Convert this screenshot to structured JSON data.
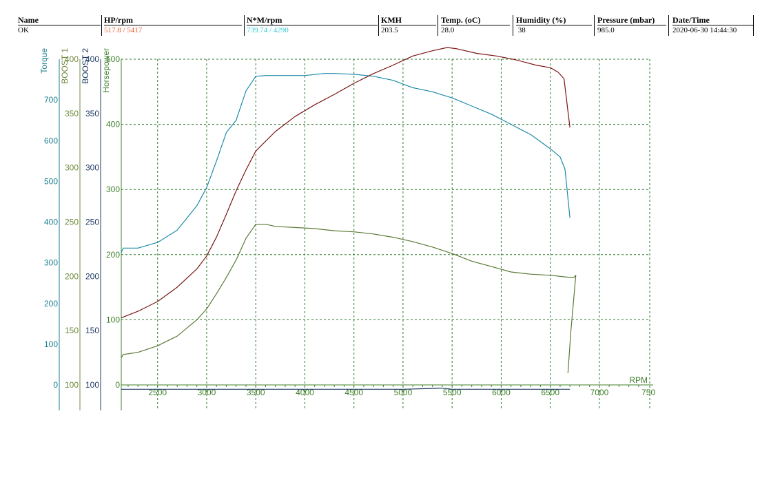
{
  "header": {
    "columns": [
      {
        "label": "Name",
        "value": "OK",
        "value_color": "#000000"
      },
      {
        "label": "HP/rpm",
        "value": "517.8 / 5417",
        "value_color": "#e8572c"
      },
      {
        "label": "N*M/rpm",
        "value": "739.74 / 4290",
        "value_color": "#2fc9d4"
      },
      {
        "label": "KMH",
        "value": "203.5",
        "value_color": "#000000"
      },
      {
        "label": "Temp. (oC)",
        "value": "28.0",
        "value_color": "#000000"
      },
      {
        "label": "Humidity (%)",
        "value": " 38",
        "value_color": "#000000"
      },
      {
        "label": "Pressure (mbar)",
        "value": "985.0",
        "value_color": "#000000"
      },
      {
        "label": "Date/Time",
        "value": "2020-06-30 14:44:30",
        "value_color": "#000000"
      }
    ]
  },
  "chart_data": {
    "type": "line",
    "xlabel": "RPM",
    "xlim": [
      2130,
      7520
    ],
    "xticks": [
      2500,
      3000,
      3500,
      4000,
      4500,
      5000,
      5500,
      6000,
      6500,
      7000
    ],
    "xtick_labels": [
      "2500",
      "3000",
      "3500",
      "4000",
      "4500",
      "5000",
      "5500",
      "6000",
      "6500",
      "7000",
      "750"
    ],
    "grid": true,
    "axes": [
      {
        "name": "Torque",
        "color": "#1b7f8f",
        "range": [
          0,
          800
        ],
        "ticks": [
          0,
          100,
          200,
          300,
          400,
          500,
          600,
          700
        ]
      },
      {
        "name": "BOOST 1",
        "color": "#6e8a3c",
        "range": [
          100,
          400
        ],
        "ticks": [
          100,
          150,
          200,
          250,
          300,
          350,
          400
        ]
      },
      {
        "name": "BOOST 2",
        "color": "#1f3a63",
        "range": [
          100,
          400
        ],
        "ticks": [
          100,
          150,
          200,
          250,
          300,
          350,
          400
        ]
      },
      {
        "name": "Horsepower",
        "color": "#3f7f2a",
        "range": [
          0,
          500
        ],
        "ticks": [
          0,
          100,
          200,
          300,
          400,
          500
        ]
      }
    ],
    "series": [
      {
        "name": "Torque",
        "axis": "Torque",
        "color": "#1e8aa8",
        "x": [
          2130,
          2150,
          2300,
          2500,
          2700,
          2900,
          3000,
          3100,
          3200,
          3300,
          3400,
          3500,
          3600,
          3800,
          4000,
          4200,
          4300,
          4500,
          4700,
          4900,
          5100,
          5300,
          5500,
          5700,
          5900,
          6100,
          6300,
          6500,
          6600,
          6650,
          6700
        ],
        "y": [
          325,
          336,
          336,
          350,
          380,
          440,
          485,
          550,
          620,
          650,
          722,
          758,
          760,
          760,
          760,
          765,
          765,
          763,
          758,
          748,
          730,
          720,
          705,
          685,
          665,
          640,
          615,
          580,
          560,
          530,
          410
        ]
      },
      {
        "name": "Horsepower",
        "axis": "Horsepower",
        "color": "#7a1414",
        "x": [
          2130,
          2300,
          2500,
          2700,
          2900,
          3000,
          3100,
          3200,
          3300,
          3400,
          3500,
          3700,
          3900,
          4100,
          4300,
          4500,
          4700,
          4900,
          5100,
          5300,
          5450,
          5550,
          5750,
          5950,
          6150,
          6350,
          6500,
          6580,
          6640,
          6680,
          6700
        ],
        "y": [
          103,
          113,
          128,
          150,
          178,
          198,
          227,
          262,
          298,
          330,
          359,
          389,
          412,
          430,
          446,
          463,
          478,
          491,
          505,
          513,
          518,
          516,
          509,
          505,
          499,
          491,
          487,
          480,
          470,
          420,
          395
        ]
      },
      {
        "name": "BOOST 1",
        "axis": "BOOST 1",
        "color": "#5a7a35",
        "x": [
          2130,
          2150,
          2300,
          2500,
          2700,
          2900,
          3000,
          3100,
          3200,
          3300,
          3400,
          3500,
          3600,
          3700,
          3900,
          4100,
          4300,
          4500,
          4700,
          4900,
          5100,
          5300,
          5500,
          5700,
          5900,
          6100,
          6300,
          6500,
          6700,
          6740,
          6760,
          6710,
          6680
        ],
        "y": [
          125,
          128,
          130,
          136,
          145,
          160,
          170,
          184,
          199,
          215,
          235,
          248,
          248,
          246,
          245,
          244,
          242,
          241,
          239,
          236,
          232,
          227,
          221,
          214,
          209,
          204,
          202,
          201,
          199,
          199,
          201,
          150,
          111
        ]
      },
      {
        "name": "BOOST 2",
        "axis": "BOOST 2",
        "color": "#1f3a63",
        "x": [
          2130,
          3000,
          4000,
          5000,
          5400,
          5500,
          6000,
          6700
        ],
        "y": [
          96,
          96,
          96,
          96,
          97,
          96,
          96,
          96
        ]
      }
    ]
  }
}
